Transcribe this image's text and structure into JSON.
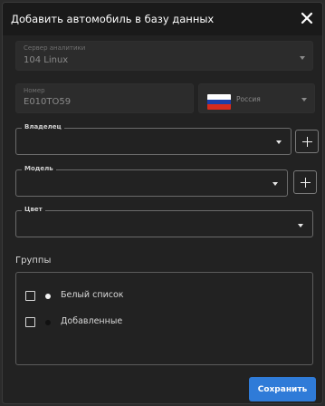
{
  "dialog": {
    "title": "Добавить автомобиль в базу данных",
    "close_icon": "close-icon"
  },
  "server": {
    "label": "Сервер аналитики",
    "value": "104 Linux",
    "disabled": true
  },
  "number": {
    "label": "Номер",
    "value": "E010TO59",
    "disabled": true
  },
  "country": {
    "value": "Россия",
    "flag_colors": [
      "#ffffff",
      "#1c3fa8",
      "#d52b1e"
    ],
    "disabled": true
  },
  "owner": {
    "label": "Владелец",
    "value": ""
  },
  "model": {
    "label": "Модель",
    "value": ""
  },
  "color": {
    "label": "Цвет",
    "value": ""
  },
  "groups": {
    "title": "Группы",
    "items": [
      {
        "label": "Белый список",
        "checked": false,
        "dot_color": "#f2f2f2"
      },
      {
        "label": "Добавленные",
        "checked": false,
        "dot_color": "#111111"
      }
    ]
  },
  "actions": {
    "save_label": "Сохранить"
  },
  "colors": {
    "accent": "#2f7bd8",
    "background": "#222222",
    "titlebar": "#1a1a1a"
  }
}
